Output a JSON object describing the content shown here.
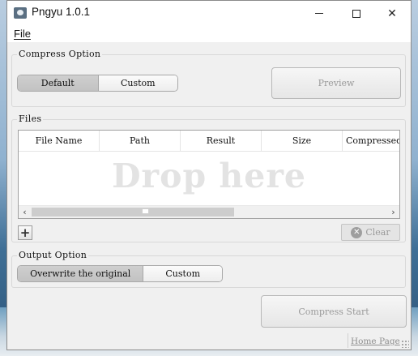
{
  "window": {
    "title": "Pngyu 1.0.1",
    "controls": {
      "minimize_icon": "minimize-icon",
      "maximize_icon": "maximize-icon",
      "close_icon": "close-icon"
    }
  },
  "menu": {
    "items": [
      {
        "label": "File"
      }
    ]
  },
  "compress_option": {
    "label": "Compress Option",
    "options": [
      {
        "label": "Default",
        "selected": true
      },
      {
        "label": "Custom",
        "selected": false
      }
    ],
    "preview_label": "Preview"
  },
  "files": {
    "label": "Files",
    "columns": [
      "File Name",
      "Path",
      "Result",
      "Size",
      "Compressed Size"
    ],
    "drop_hint": "Drop here",
    "rows": [],
    "scroll": {
      "left_icon": "chevron-left-icon",
      "right_icon": "chevron-right-icon"
    },
    "add_label": "+",
    "clear_label": "Clear",
    "clear_icon_glyph": "✕"
  },
  "output_option": {
    "label": "Output Option",
    "options": [
      {
        "label": "Overwrite the original",
        "selected": true
      },
      {
        "label": "Custom",
        "selected": false
      }
    ]
  },
  "actions": {
    "compress_start_label": "Compress Start",
    "home_page_label": "Home Page"
  },
  "colors": {
    "window_bg": "#f0f0f0",
    "segment_active": "#c8c8c8",
    "disabled_text": "#9a9a9a",
    "drop_hint": "#e3e3e3"
  }
}
